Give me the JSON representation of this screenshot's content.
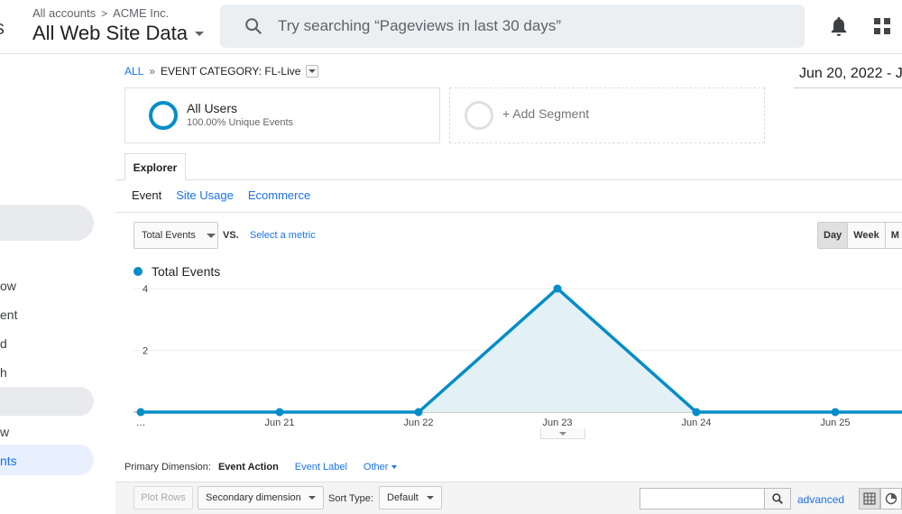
{
  "header": {
    "breadcrumb": [
      "All accounts",
      "ACME Inc."
    ],
    "property_title": "All Web Site Data",
    "search_placeholder": "Try searching “Pageviews in last 30 days”",
    "left_partial": "s"
  },
  "sidebar": {
    "items": [
      {
        "label": "ow",
        "active": false
      },
      {
        "label": "ent",
        "active": false
      },
      {
        "label": "d",
        "active": false
      },
      {
        "label": "h",
        "active": false
      },
      {
        "label": "w",
        "active": false
      },
      {
        "label": "nts",
        "active": true
      }
    ]
  },
  "event_breadcrumb": {
    "all": "ALL",
    "separator": "»",
    "category": "EVENT CATEGORY: FL-Live"
  },
  "date_range": "Jun 20, 2022 - J",
  "segments": {
    "primary": {
      "title": "All Users",
      "subtitle": "100.00% Unique Events"
    },
    "add": "+ Add Segment"
  },
  "tabs": {
    "explorer": "Explorer"
  },
  "subtabs": [
    "Event",
    "Site Usage",
    "Ecommerce"
  ],
  "metric": {
    "selected": "Total Events",
    "vs": "VS.",
    "select_metric": "Select a metric"
  },
  "period_buttons": [
    {
      "label": "Day",
      "active": true
    },
    {
      "label": "Week",
      "active": false
    },
    {
      "label": "M",
      "active": false
    }
  ],
  "chart_data": {
    "type": "area",
    "series": [
      {
        "name": "Total Events",
        "values": [
          0,
          0,
          0,
          4,
          0,
          0,
          0
        ]
      }
    ],
    "categories": [
      "…",
      "Jun 21",
      "Jun 22",
      "Jun 23",
      "Jun 24",
      "Jun 25",
      ""
    ],
    "yticks": [
      "4",
      "2"
    ],
    "ylim": [
      0,
      4
    ],
    "color": "#058dc7",
    "fill": "#e3f1f7",
    "grid": true
  },
  "primary_dimension": {
    "label": "Primary Dimension:",
    "selected": "Event Action",
    "options": [
      "Event Label"
    ],
    "other": "Other"
  },
  "table_toolbar": {
    "plot_rows": "Plot Rows",
    "secondary_dimension": "Secondary dimension",
    "sort_type_label": "Sort Type:",
    "sort_type": "Default",
    "advanced": "advanced"
  }
}
